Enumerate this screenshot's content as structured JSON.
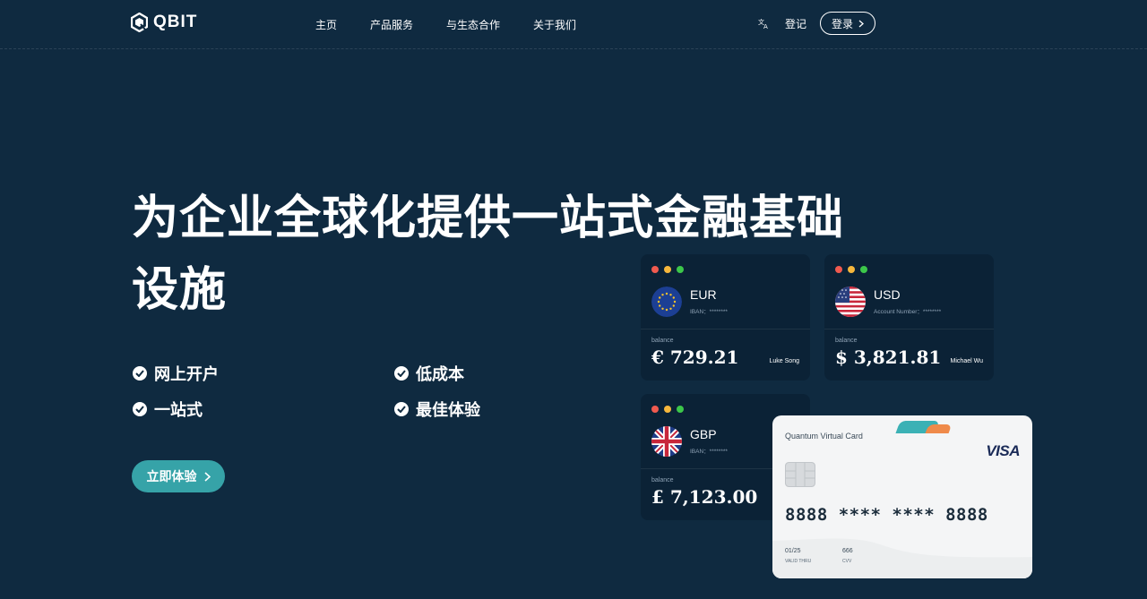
{
  "nav": {
    "logo_text": "QBIT",
    "menu": [
      "主页",
      "产品服务",
      "与生态合作",
      "关于我们"
    ],
    "register_label": "登记",
    "login_label": "登录"
  },
  "hero": {
    "title_line1": "为企业全球化提供一站式金融基础",
    "title_line2": "设施",
    "features": [
      "网上开户",
      "低成本",
      "一站式",
      "最佳体验"
    ],
    "cta_label": "立即体验"
  },
  "accounts": [
    {
      "currency": "EUR",
      "id_label": "IBAN：********",
      "balance_label": "balance",
      "balance": "€ 729.21",
      "owner": "Luke Song"
    },
    {
      "currency": "USD",
      "id_label": "Account Number：********",
      "balance_label": "balance",
      "balance": "$ 3,821.81",
      "owner": "Michael Wu"
    },
    {
      "currency": "GBP",
      "id_label": "IBAN：********",
      "balance_label": "balance",
      "balance": "£ 7,123.00",
      "owner": ""
    }
  ],
  "virtual_card": {
    "name": "Quantum Virtual Card",
    "brand": "VISA",
    "number": "8888 **** **** 8888",
    "valid_value": "01/25",
    "valid_label": "VALID THRU",
    "cvv_value": "666",
    "cvv_label": "CVV"
  },
  "colors": {
    "background": "#0f2a40",
    "card_background": "#0b2236",
    "cta": "#36a3a8",
    "dot_red": "#f05a4f",
    "dot_yellow": "#f6b73c",
    "dot_green": "#3cc74a"
  }
}
